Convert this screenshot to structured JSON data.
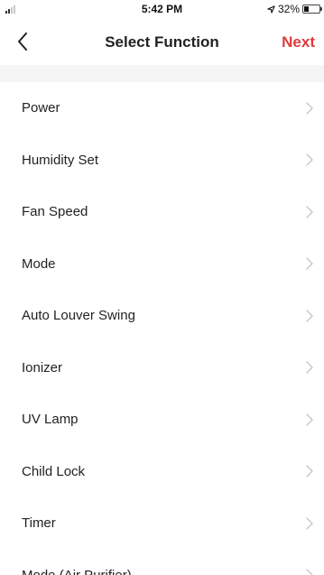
{
  "status_bar": {
    "time": "5:42 PM",
    "battery_text": "32%",
    "battery_level": 0.32,
    "icons": [
      "signal-icon",
      "location-arrow-icon",
      "battery-icon"
    ]
  },
  "nav": {
    "back_icon": "chevron-left-icon",
    "title": "Select Function",
    "next_label": "Next",
    "accent_color": "#e0393e"
  },
  "functions": [
    {
      "label": "Power"
    },
    {
      "label": "Humidity Set"
    },
    {
      "label": "Fan Speed"
    },
    {
      "label": "Mode"
    },
    {
      "label": "Auto Louver Swing"
    },
    {
      "label": "Ionizer"
    },
    {
      "label": "UV Lamp"
    },
    {
      "label": "Child Lock"
    },
    {
      "label": "Timer"
    },
    {
      "label": "Mode (Air Purifier)"
    }
  ],
  "item_icon": "chevron-right-icon"
}
